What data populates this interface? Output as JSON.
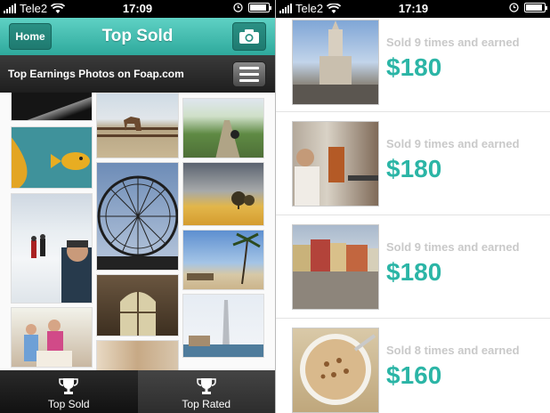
{
  "left_screen": {
    "status": {
      "carrier": "Tele2",
      "time": "17:09"
    },
    "nav": {
      "home_label": "Home",
      "title": "Top Sold"
    },
    "subtitle": "Top Earnings Photos on Foap.com",
    "tabs": [
      {
        "label": "Top Sold",
        "state": "active"
      },
      {
        "label": "Top Rated",
        "state": "inactive"
      }
    ]
  },
  "right_screen": {
    "status": {
      "carrier": "Tele2",
      "time": "17:19"
    },
    "items": [
      {
        "sold_text": "Sold 9 times and earned",
        "amount": "$180"
      },
      {
        "sold_text": "Sold 9 times and earned",
        "amount": "$180"
      },
      {
        "sold_text": "Sold 9 times and earned",
        "amount": "$180"
      },
      {
        "sold_text": "Sold 8 times and earned",
        "amount": "$160"
      }
    ]
  },
  "colors": {
    "accent": "#2bb5a6",
    "nav_gradient_top": "#5fd1c4",
    "nav_gradient_bottom": "#2ea99c"
  },
  "icons": [
    "wifi-icon",
    "alarm-icon",
    "battery-icon",
    "camera-icon",
    "menu-icon",
    "trophy-icon"
  ]
}
